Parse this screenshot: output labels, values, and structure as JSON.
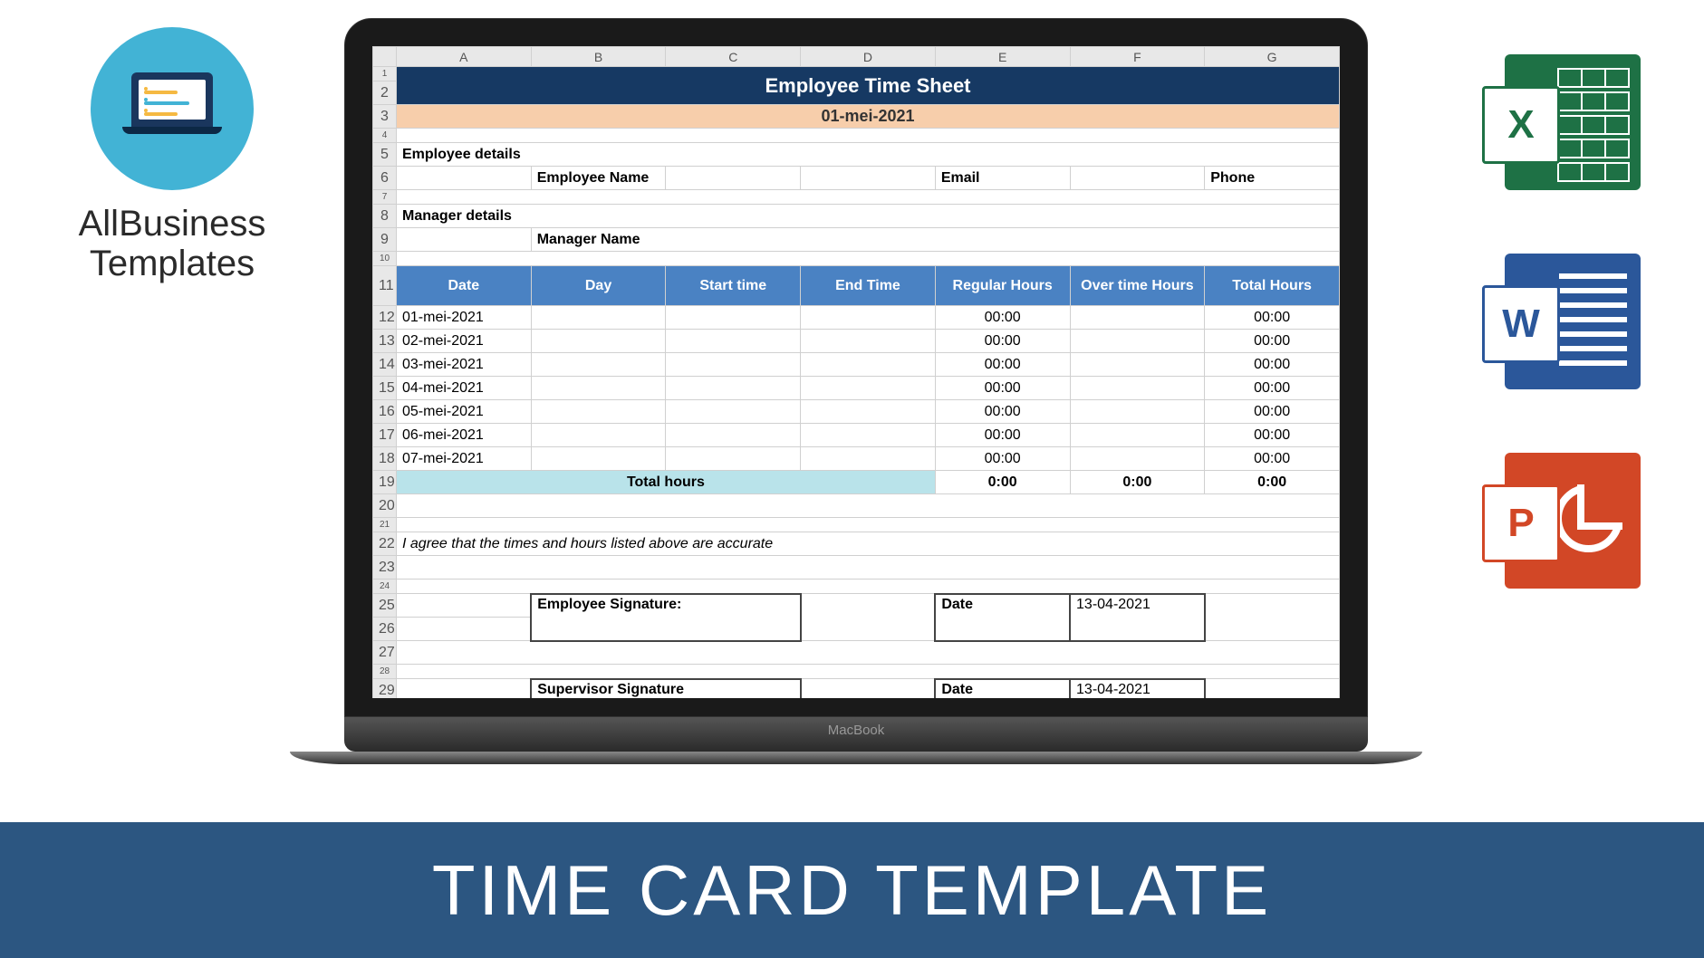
{
  "logo": {
    "line1": "AllBusiness",
    "line2": "Templates"
  },
  "banner": "TIME CARD TEMPLATE",
  "macbook_label": "MacBook",
  "icons": {
    "excel": "X",
    "word": "W",
    "ppt": "P"
  },
  "sheet": {
    "columns": [
      "A",
      "B",
      "C",
      "D",
      "E",
      "F",
      "G"
    ],
    "title": "Employee Time Sheet",
    "period_date": "01-mei-2021",
    "emp_details_label": "Employee details",
    "emp_name_label": "Employee Name",
    "email_label": "Email",
    "phone_label": "Phone",
    "mgr_details_label": "Manager details",
    "mgr_name_label": "Manager Name",
    "headers": [
      "Date",
      "Day",
      "Start time",
      "End Time",
      "Regular Hours",
      "Over time Hours",
      "Total Hours"
    ],
    "rows": [
      {
        "n": "12",
        "date": "01-mei-2021",
        "reg": "00:00",
        "tot": "00:00"
      },
      {
        "n": "13",
        "date": "02-mei-2021",
        "reg": "00:00",
        "tot": "00:00"
      },
      {
        "n": "14",
        "date": "03-mei-2021",
        "reg": "00:00",
        "tot": "00:00"
      },
      {
        "n": "15",
        "date": "04-mei-2021",
        "reg": "00:00",
        "tot": "00:00"
      },
      {
        "n": "16",
        "date": "05-mei-2021",
        "reg": "00:00",
        "tot": "00:00"
      },
      {
        "n": "17",
        "date": "06-mei-2021",
        "reg": "00:00",
        "tot": "00:00"
      },
      {
        "n": "18",
        "date": "07-mei-2021",
        "reg": "00:00",
        "tot": "00:00"
      }
    ],
    "total_label": "Total hours",
    "total_reg": "0:00",
    "total_ot": "0:00",
    "total_tot": "0:00",
    "agreement": "I agree that the times and hours listed above are accurate",
    "emp_sig_label": "Employee Signature:",
    "sup_sig_label": "Supervisor Signature",
    "date_label": "Date",
    "sig_date": "13-04-2021"
  }
}
